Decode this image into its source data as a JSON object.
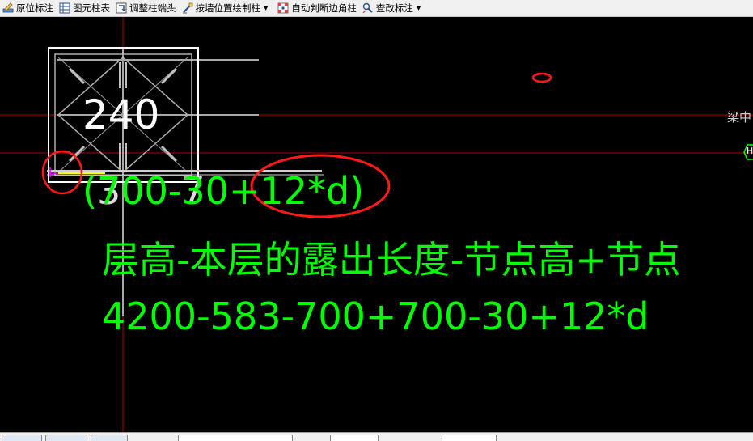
{
  "toolbar": {
    "items": [
      {
        "label": "原位标注",
        "icon": "pencil-ruler-icon"
      },
      {
        "label": "图元柱表",
        "icon": "table-grid-icon"
      },
      {
        "label": "调整柱端头",
        "icon": "adjust-column-icon"
      },
      {
        "label": "按墙位置绘制柱",
        "icon": "wall-column-icon",
        "dropdown": true
      },
      {
        "label": "自动判断边角柱",
        "icon": "corner-column-icon"
      },
      {
        "label": "查改标注",
        "icon": "edit-annotation-icon",
        "dropdown": true
      }
    ]
  },
  "canvas": {
    "column_label": "240",
    "overlap_text": "(700-30+12*d)",
    "overlap_under_text": "(300-7",
    "formula_words": "层高-本层的露出长度-节点高+节点",
    "formula_numbers": "4200-583-700+700-30+12*d",
    "side_label_1": "梁中",
    "side_label_2": "H",
    "colors": {
      "background": "#000000",
      "formula_green": "#00ff00",
      "axis_red": "#c00000",
      "annotation_red": "#ff1a1a",
      "rebar_gray": "#a8a8a8",
      "column_outline": "#ffffff"
    }
  }
}
